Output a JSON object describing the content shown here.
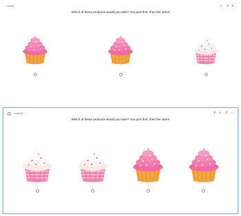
{
  "cards": [
    {
      "id": "cem11",
      "question": "Which of these products would you take? You pick first, then the other!",
      "toolbar": [
        "×",
        "⤨",
        "↻"
      ],
      "options": [
        "pink-frosting-cupcake",
        "pink-frosting-cupcake",
        "white-frosting-cupcake"
      ]
    },
    {
      "id": "control2",
      "question": "Which of these products would you take? You pick first, then the other!",
      "toolbar": [
        "⚲",
        "×",
        "⤨",
        "⋯"
      ],
      "options": [
        "white-frosting-cupcake",
        "white-frosting-cupcake",
        "pink-frosting-cupcake",
        "pink-frosting-cupcake"
      ]
    }
  ],
  "colors": {
    "selected_border": "#8fb4e8",
    "pink_frosting": "#f06aa0",
    "white_frosting": "#fbf5f2",
    "golden_cake": "#f2a541",
    "pink_liner": "#f28bb1"
  }
}
